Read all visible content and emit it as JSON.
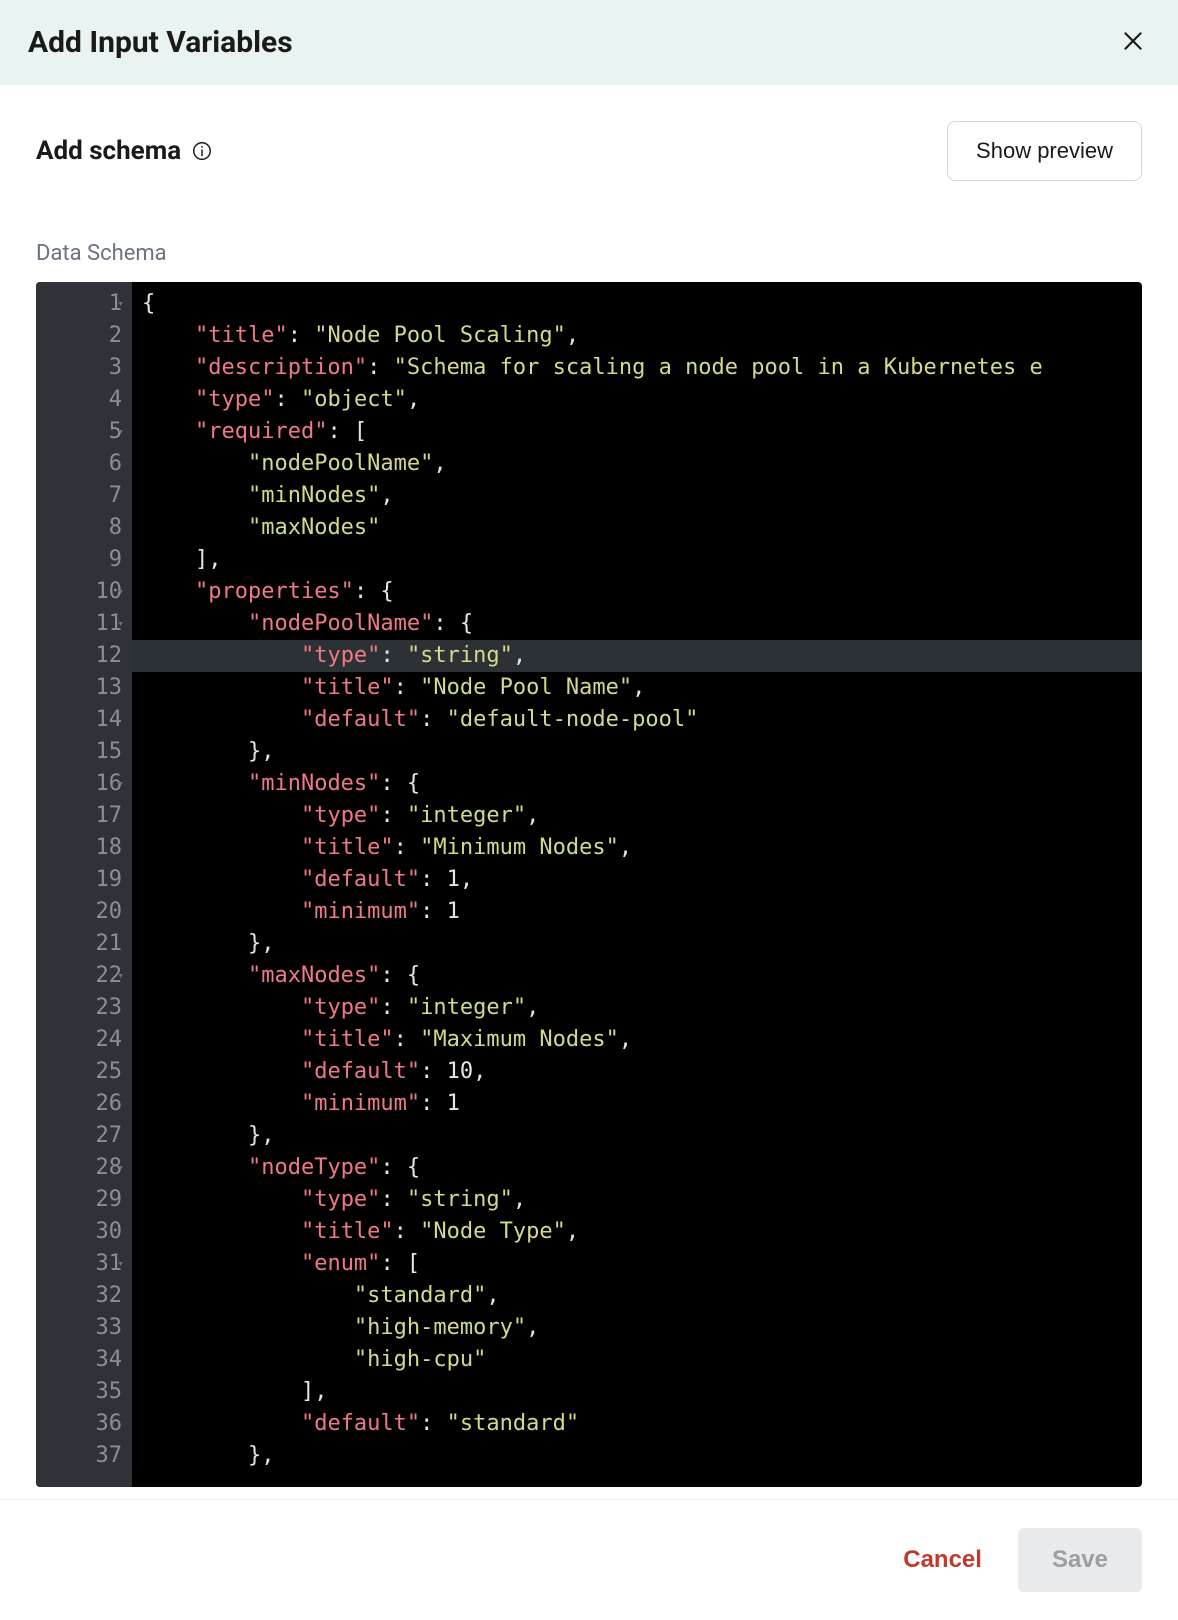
{
  "dialog": {
    "title": "Add Input Variables",
    "subtitle": "Add schema",
    "preview_label": "Show preview",
    "field_label": "Data Schema",
    "cancel_label": "Cancel",
    "save_label": "Save"
  },
  "editor": {
    "active_line": 12,
    "foldable_lines": [
      1,
      5,
      10,
      11,
      16,
      22,
      28,
      31
    ],
    "lines": [
      {
        "n": 1,
        "tokens": [
          {
            "t": "punc",
            "v": "{"
          }
        ]
      },
      {
        "n": 2,
        "tokens": [
          {
            "t": "pad",
            "v": "    "
          },
          {
            "t": "key",
            "v": "\"title\""
          },
          {
            "t": "punc",
            "v": ": "
          },
          {
            "t": "str",
            "v": "\"Node Pool Scaling\""
          },
          {
            "t": "punc",
            "v": ","
          }
        ]
      },
      {
        "n": 3,
        "tokens": [
          {
            "t": "pad",
            "v": "    "
          },
          {
            "t": "key",
            "v": "\"description\""
          },
          {
            "t": "punc",
            "v": ": "
          },
          {
            "t": "str",
            "v": "\"Schema for scaling a node pool in a Kubernetes e"
          }
        ]
      },
      {
        "n": 4,
        "tokens": [
          {
            "t": "pad",
            "v": "    "
          },
          {
            "t": "key",
            "v": "\"type\""
          },
          {
            "t": "punc",
            "v": ": "
          },
          {
            "t": "str",
            "v": "\"object\""
          },
          {
            "t": "punc",
            "v": ","
          }
        ]
      },
      {
        "n": 5,
        "tokens": [
          {
            "t": "pad",
            "v": "    "
          },
          {
            "t": "key",
            "v": "\"required\""
          },
          {
            "t": "punc",
            "v": ": ["
          }
        ]
      },
      {
        "n": 6,
        "tokens": [
          {
            "t": "pad",
            "v": "        "
          },
          {
            "t": "str",
            "v": "\"nodePoolName\""
          },
          {
            "t": "punc",
            "v": ","
          }
        ]
      },
      {
        "n": 7,
        "tokens": [
          {
            "t": "pad",
            "v": "        "
          },
          {
            "t": "str",
            "v": "\"minNodes\""
          },
          {
            "t": "punc",
            "v": ","
          }
        ]
      },
      {
        "n": 8,
        "tokens": [
          {
            "t": "pad",
            "v": "        "
          },
          {
            "t": "str",
            "v": "\"maxNodes\""
          }
        ]
      },
      {
        "n": 9,
        "tokens": [
          {
            "t": "pad",
            "v": "    "
          },
          {
            "t": "punc",
            "v": "],"
          }
        ]
      },
      {
        "n": 10,
        "tokens": [
          {
            "t": "pad",
            "v": "    "
          },
          {
            "t": "key",
            "v": "\"properties\""
          },
          {
            "t": "punc",
            "v": ": {"
          }
        ]
      },
      {
        "n": 11,
        "tokens": [
          {
            "t": "pad",
            "v": "        "
          },
          {
            "t": "key",
            "v": "\"nodePoolName\""
          },
          {
            "t": "punc",
            "v": ": {"
          }
        ]
      },
      {
        "n": 12,
        "tokens": [
          {
            "t": "pad",
            "v": "            "
          },
          {
            "t": "key",
            "v": "\"type\""
          },
          {
            "t": "punc",
            "v": ": "
          },
          {
            "t": "str",
            "v": "\"string\""
          },
          {
            "t": "punc",
            "v": ","
          }
        ]
      },
      {
        "n": 13,
        "tokens": [
          {
            "t": "pad",
            "v": "            "
          },
          {
            "t": "key",
            "v": "\"title\""
          },
          {
            "t": "punc",
            "v": ": "
          },
          {
            "t": "str",
            "v": "\"Node Pool Name\""
          },
          {
            "t": "punc",
            "v": ","
          }
        ]
      },
      {
        "n": 14,
        "tokens": [
          {
            "t": "pad",
            "v": "            "
          },
          {
            "t": "key",
            "v": "\"default\""
          },
          {
            "t": "punc",
            "v": ": "
          },
          {
            "t": "str",
            "v": "\"default-node-pool\""
          }
        ]
      },
      {
        "n": 15,
        "tokens": [
          {
            "t": "pad",
            "v": "        "
          },
          {
            "t": "punc",
            "v": "},"
          }
        ]
      },
      {
        "n": 16,
        "tokens": [
          {
            "t": "pad",
            "v": "        "
          },
          {
            "t": "key",
            "v": "\"minNodes\""
          },
          {
            "t": "punc",
            "v": ": {"
          }
        ]
      },
      {
        "n": 17,
        "tokens": [
          {
            "t": "pad",
            "v": "            "
          },
          {
            "t": "key",
            "v": "\"type\""
          },
          {
            "t": "punc",
            "v": ": "
          },
          {
            "t": "str",
            "v": "\"integer\""
          },
          {
            "t": "punc",
            "v": ","
          }
        ]
      },
      {
        "n": 18,
        "tokens": [
          {
            "t": "pad",
            "v": "            "
          },
          {
            "t": "key",
            "v": "\"title\""
          },
          {
            "t": "punc",
            "v": ": "
          },
          {
            "t": "str",
            "v": "\"Minimum Nodes\""
          },
          {
            "t": "punc",
            "v": ","
          }
        ]
      },
      {
        "n": 19,
        "tokens": [
          {
            "t": "pad",
            "v": "            "
          },
          {
            "t": "key",
            "v": "\"default\""
          },
          {
            "t": "punc",
            "v": ": "
          },
          {
            "t": "num",
            "v": "1"
          },
          {
            "t": "punc",
            "v": ","
          }
        ]
      },
      {
        "n": 20,
        "tokens": [
          {
            "t": "pad",
            "v": "            "
          },
          {
            "t": "key",
            "v": "\"minimum\""
          },
          {
            "t": "punc",
            "v": ": "
          },
          {
            "t": "num",
            "v": "1"
          }
        ]
      },
      {
        "n": 21,
        "tokens": [
          {
            "t": "pad",
            "v": "        "
          },
          {
            "t": "punc",
            "v": "},"
          }
        ]
      },
      {
        "n": 22,
        "tokens": [
          {
            "t": "pad",
            "v": "        "
          },
          {
            "t": "key",
            "v": "\"maxNodes\""
          },
          {
            "t": "punc",
            "v": ": {"
          }
        ]
      },
      {
        "n": 23,
        "tokens": [
          {
            "t": "pad",
            "v": "            "
          },
          {
            "t": "key",
            "v": "\"type\""
          },
          {
            "t": "punc",
            "v": ": "
          },
          {
            "t": "str",
            "v": "\"integer\""
          },
          {
            "t": "punc",
            "v": ","
          }
        ]
      },
      {
        "n": 24,
        "tokens": [
          {
            "t": "pad",
            "v": "            "
          },
          {
            "t": "key",
            "v": "\"title\""
          },
          {
            "t": "punc",
            "v": ": "
          },
          {
            "t": "str",
            "v": "\"Maximum Nodes\""
          },
          {
            "t": "punc",
            "v": ","
          }
        ]
      },
      {
        "n": 25,
        "tokens": [
          {
            "t": "pad",
            "v": "            "
          },
          {
            "t": "key",
            "v": "\"default\""
          },
          {
            "t": "punc",
            "v": ": "
          },
          {
            "t": "num",
            "v": "10"
          },
          {
            "t": "punc",
            "v": ","
          }
        ]
      },
      {
        "n": 26,
        "tokens": [
          {
            "t": "pad",
            "v": "            "
          },
          {
            "t": "key",
            "v": "\"minimum\""
          },
          {
            "t": "punc",
            "v": ": "
          },
          {
            "t": "num",
            "v": "1"
          }
        ]
      },
      {
        "n": 27,
        "tokens": [
          {
            "t": "pad",
            "v": "        "
          },
          {
            "t": "punc",
            "v": "},"
          }
        ]
      },
      {
        "n": 28,
        "tokens": [
          {
            "t": "pad",
            "v": "        "
          },
          {
            "t": "key",
            "v": "\"nodeType\""
          },
          {
            "t": "punc",
            "v": ": {"
          }
        ]
      },
      {
        "n": 29,
        "tokens": [
          {
            "t": "pad",
            "v": "            "
          },
          {
            "t": "key",
            "v": "\"type\""
          },
          {
            "t": "punc",
            "v": ": "
          },
          {
            "t": "str",
            "v": "\"string\""
          },
          {
            "t": "punc",
            "v": ","
          }
        ]
      },
      {
        "n": 30,
        "tokens": [
          {
            "t": "pad",
            "v": "            "
          },
          {
            "t": "key",
            "v": "\"title\""
          },
          {
            "t": "punc",
            "v": ": "
          },
          {
            "t": "str",
            "v": "\"Node Type\""
          },
          {
            "t": "punc",
            "v": ","
          }
        ]
      },
      {
        "n": 31,
        "tokens": [
          {
            "t": "pad",
            "v": "            "
          },
          {
            "t": "key",
            "v": "\"enum\""
          },
          {
            "t": "punc",
            "v": ": ["
          }
        ]
      },
      {
        "n": 32,
        "tokens": [
          {
            "t": "pad",
            "v": "                "
          },
          {
            "t": "str",
            "v": "\"standard\""
          },
          {
            "t": "punc",
            "v": ","
          }
        ]
      },
      {
        "n": 33,
        "tokens": [
          {
            "t": "pad",
            "v": "                "
          },
          {
            "t": "str",
            "v": "\"high-memory\""
          },
          {
            "t": "punc",
            "v": ","
          }
        ]
      },
      {
        "n": 34,
        "tokens": [
          {
            "t": "pad",
            "v": "                "
          },
          {
            "t": "str",
            "v": "\"high-cpu\""
          }
        ]
      },
      {
        "n": 35,
        "tokens": [
          {
            "t": "pad",
            "v": "            "
          },
          {
            "t": "punc",
            "v": "],"
          }
        ]
      },
      {
        "n": 36,
        "tokens": [
          {
            "t": "pad",
            "v": "            "
          },
          {
            "t": "key",
            "v": "\"default\""
          },
          {
            "t": "punc",
            "v": ": "
          },
          {
            "t": "str",
            "v": "\"standard\""
          }
        ]
      },
      {
        "n": 37,
        "tokens": [
          {
            "t": "pad",
            "v": "        "
          },
          {
            "t": "punc",
            "v": "},"
          }
        ]
      }
    ]
  }
}
